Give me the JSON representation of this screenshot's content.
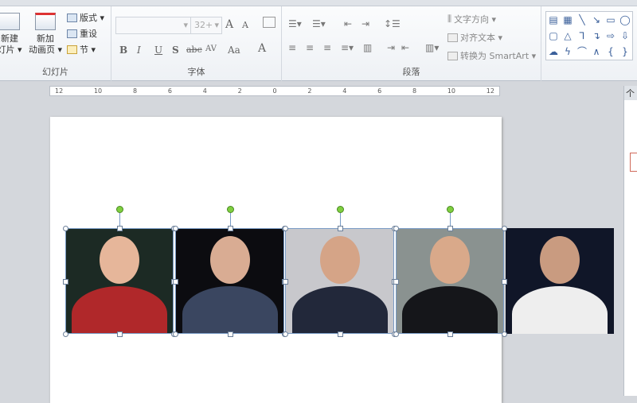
{
  "ribbon": {
    "slides_group": {
      "label": "幻灯片",
      "new_slide": "新建\n灯片",
      "new_slide_l1": "新建",
      "new_slide_l2": "灯片 ▾",
      "new_anim_l1": "新加",
      "new_anim_l2": "动画页 ▾",
      "layout": "版式 ▾",
      "reset": "重设",
      "section": "节 ▾"
    },
    "font_group": {
      "label": "字体",
      "font_name": "",
      "font_size": "32+",
      "grow": "A",
      "shrink": "A",
      "bold": "B",
      "italic": "I",
      "underline": "U",
      "shadow": "S",
      "strike": "abc",
      "spacing": "AV",
      "case": "Aa",
      "color": "A"
    },
    "paragraph_group": {
      "label": "段落",
      "text_direction": "文字方向 ▾",
      "align_text": "对齐文本 ▾",
      "smartart": "转换为 SmartArt ▾"
    },
    "shapes": [
      "▤",
      "▦",
      "╲",
      "↘",
      "▭",
      "◯",
      "▢",
      "△",
      "⅂",
      "↴",
      "⇨",
      "⇩",
      "☁",
      "ϟ",
      "⌒",
      "∧",
      "{",
      "}"
    ]
  },
  "ruler": {
    "ticks": [
      "12",
      "10",
      "8",
      "6",
      "4",
      "2",
      "0",
      "2",
      "4",
      "6",
      "8",
      "10",
      "12"
    ]
  },
  "side_pane": {
    "title": "个"
  },
  "accent": {
    "selection": "#7a9cc6",
    "rotate_handle": "#7fcf3f"
  }
}
